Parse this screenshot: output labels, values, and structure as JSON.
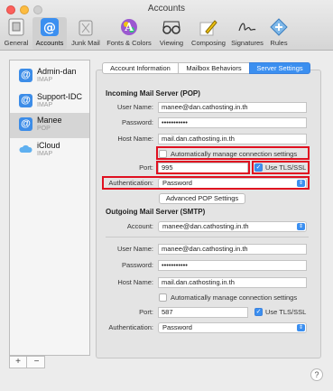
{
  "window": {
    "title": "Accounts"
  },
  "toolbar": {
    "items": [
      {
        "label": "General",
        "icon": "general-icon"
      },
      {
        "label": "Accounts",
        "icon": "at-sign-icon"
      },
      {
        "label": "Junk Mail",
        "icon": "trash-icon"
      },
      {
        "label": "Fonts & Colors",
        "icon": "fonts-colors-icon"
      },
      {
        "label": "Viewing",
        "icon": "glasses-icon"
      },
      {
        "label": "Composing",
        "icon": "pencil-icon"
      },
      {
        "label": "Signatures",
        "icon": "signature-icon"
      },
      {
        "label": "Rules",
        "icon": "rules-icon"
      }
    ],
    "active": "Accounts"
  },
  "sidebar": {
    "accounts": [
      {
        "name": "Admin-dan",
        "type": "IMAP",
        "icon": "at-sign-icon"
      },
      {
        "name": "Support-IDC",
        "type": "IMAP",
        "icon": "at-sign-icon"
      },
      {
        "name": "Manee",
        "type": "POP",
        "icon": "at-sign-icon"
      },
      {
        "name": "iCloud",
        "type": "IMAP",
        "icon": "cloud-icon"
      }
    ],
    "selected": "Manee",
    "add_label": "+",
    "remove_label": "−"
  },
  "tabs": [
    "Account Information",
    "Mailbox Behaviors",
    "Server Settings"
  ],
  "active_tab": "Server Settings",
  "incoming": {
    "title": "Incoming Mail Server (POP)",
    "user_name_label": "User Name:",
    "user_name": "manee@dan.cathosting.in.th",
    "password_label": "Password:",
    "password": "•••••••••••",
    "host_label": "Host Name:",
    "host": "mail.dan.cathosting.in.th",
    "auto_manage_label": "Automatically manage connection settings",
    "auto_manage_checked": false,
    "port_label": "Port:",
    "port": "995",
    "tls_label": "Use TLS/SSL",
    "tls_checked": true,
    "auth_label": "Authentication:",
    "auth": "Password",
    "advanced_button": "Advanced POP Settings"
  },
  "outgoing": {
    "title": "Outgoing Mail Server (SMTP)",
    "account_label": "Account:",
    "account": "manee@dan.cathosting.in.th",
    "user_name_label": "User Name:",
    "user_name": "manee@dan.cathosting.in.th",
    "password_label": "Password:",
    "password": "•••••••••••",
    "host_label": "Host Name:",
    "host": "mail.dan.cathosting.in.th",
    "auto_manage_label": "Automatically manage connection settings",
    "auto_manage_checked": false,
    "port_label": "Port:",
    "port": "587",
    "tls_label": "Use TLS/SSL",
    "tls_checked": true,
    "auth_label": "Authentication:",
    "auth": "Password"
  },
  "help_label": "?",
  "colors": {
    "accent": "#3b8ff0",
    "highlight": "#e01020"
  }
}
